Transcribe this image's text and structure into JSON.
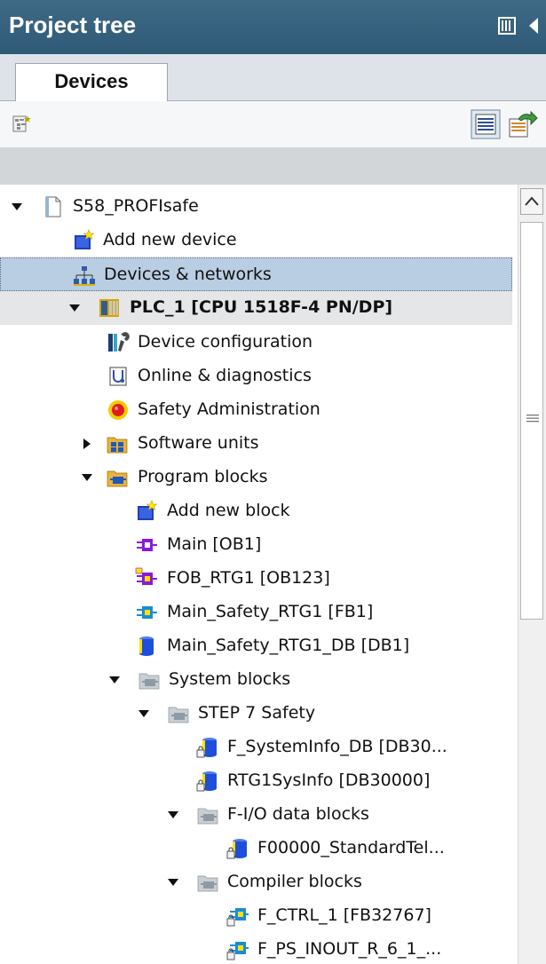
{
  "panel": {
    "title": "Project tree",
    "tab": "Devices"
  },
  "tree": [
    {
      "label": "S58_PROFIsafe",
      "icon": "project-file-icon",
      "arrow": "down",
      "name": "tree-item-project"
    },
    {
      "label": "Add new device",
      "icon": "add-device-icon",
      "arrow": "none",
      "name": "tree-item-add-new-device"
    },
    {
      "label": "Devices & networks",
      "icon": "network-icon",
      "arrow": "none",
      "name": "tree-item-devices-networks",
      "selected": true
    },
    {
      "label": "PLC_1 [CPU 1518F-4 PN/DP]",
      "icon": "plc-icon",
      "arrow": "down",
      "name": "tree-item-plc",
      "bold": true
    },
    {
      "label": "Device configuration",
      "icon": "device-config-icon",
      "arrow": "none",
      "name": "tree-item-device-configuration"
    },
    {
      "label": "Online & diagnostics",
      "icon": "diagnostics-icon",
      "arrow": "none",
      "name": "tree-item-online-diagnostics"
    },
    {
      "label": "Safety Administration",
      "icon": "safety-icon",
      "arrow": "none",
      "name": "tree-item-safety-administration"
    },
    {
      "label": "Software units",
      "icon": "software-units-icon",
      "arrow": "right",
      "name": "tree-item-software-units"
    },
    {
      "label": "Program blocks",
      "icon": "folder-icon",
      "arrow": "down",
      "name": "tree-item-program-blocks"
    },
    {
      "label": "Add new block",
      "icon": "add-block-icon",
      "arrow": "none",
      "name": "tree-item-add-new-block"
    },
    {
      "label": "Main [OB1]",
      "icon": "ob-block-icon",
      "arrow": "none",
      "name": "tree-item-main-ob1"
    },
    {
      "label": "FOB_RTG1 [OB123]",
      "icon": "safety-ob-block-icon",
      "arrow": "none",
      "name": "tree-item-fob-rtg1"
    },
    {
      "label": "Main_Safety_RTG1 [FB1]",
      "icon": "fb-block-icon",
      "arrow": "none",
      "name": "tree-item-main-safety-rtg1"
    },
    {
      "label": "Main_Safety_RTG1_DB [DB1]",
      "icon": "db-icon",
      "arrow": "none",
      "name": "tree-item-main-safety-rtg1-db"
    },
    {
      "label": "System blocks",
      "icon": "grey-folder-icon",
      "arrow": "down",
      "name": "tree-item-system-blocks"
    },
    {
      "label": "STEP 7 Safety",
      "icon": "grey-folder-icon",
      "arrow": "down",
      "name": "tree-item-step7-safety"
    },
    {
      "label": "F_SystemInfo_DB [DB30...",
      "icon": "locked-db-icon",
      "arrow": "none",
      "name": "tree-item-f-systeminfo-db"
    },
    {
      "label": "RTG1SysInfo [DB30000]",
      "icon": "locked-db-icon",
      "arrow": "none",
      "name": "tree-item-rtg1sysinfo"
    },
    {
      "label": "F-I/O data blocks",
      "icon": "grey-folder-icon",
      "arrow": "down",
      "name": "tree-item-fio-data-blocks"
    },
    {
      "label": "F00000_StandardTel...",
      "icon": "locked-db-icon",
      "arrow": "none",
      "name": "tree-item-f00000-standardtel"
    },
    {
      "label": "Compiler blocks",
      "icon": "grey-folder-icon",
      "arrow": "down",
      "name": "tree-item-compiler-blocks"
    },
    {
      "label": "F_CTRL_1 [FB32767]",
      "icon": "locked-fb-icon",
      "arrow": "none",
      "name": "tree-item-f-ctrl-1"
    },
    {
      "label": "F_PS_INOUT_R_6_1_...",
      "icon": "locked-fb-icon",
      "arrow": "none",
      "name": "tree-item-f-ps-inout"
    }
  ],
  "colors": {
    "title_bar": "#2f5a77",
    "selection": "#b9cde3",
    "plc_row": "#e4e6e8"
  }
}
